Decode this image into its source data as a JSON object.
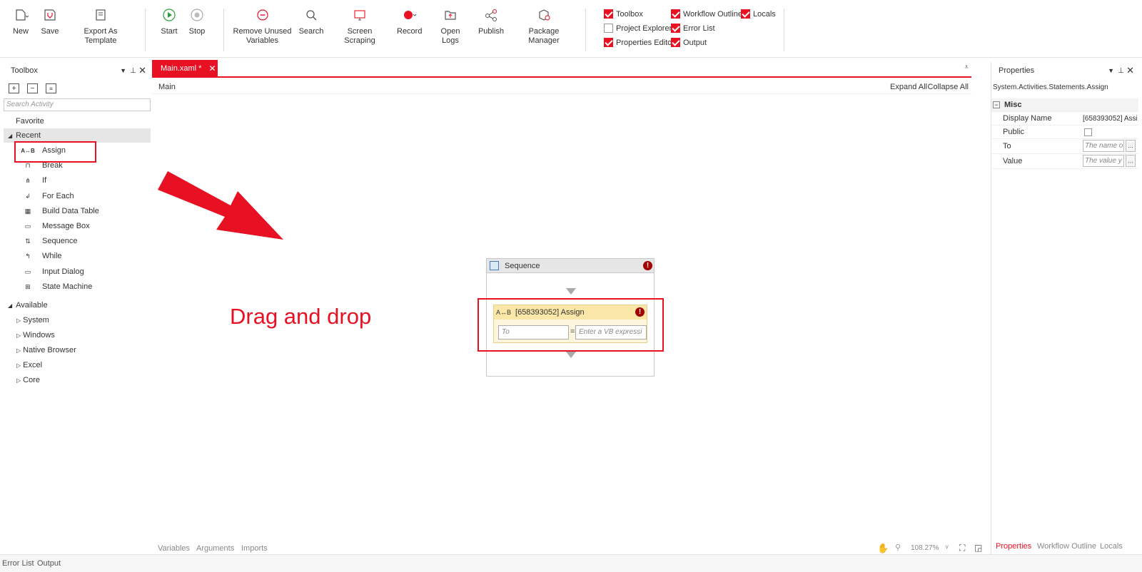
{
  "ribbon": {
    "new": "New",
    "save": "Save",
    "export_template": "Export As Template",
    "start": "Start",
    "stop": "Stop",
    "remove_unused_1": "Remove Unused",
    "remove_unused_2": "Variables",
    "search": "Search",
    "screen_scraping": "Screen Scraping",
    "record": "Record",
    "open_logs": "Open Logs",
    "publish": "Publish",
    "package_manager": "Package Manager",
    "panels": [
      {
        "label": "Toolbox",
        "checked": true
      },
      {
        "label": "Workflow Outline",
        "checked": true
      },
      {
        "label": "Locals",
        "checked": true
      },
      {
        "label": "Project Explorer",
        "checked": false
      },
      {
        "label": "Error List",
        "checked": true
      },
      {
        "label": "Properties Editor",
        "checked": true
      },
      {
        "label": "Output",
        "checked": true
      }
    ]
  },
  "toolbox": {
    "title": "Toolbox",
    "search_placeholder": "Search Activity",
    "favorite": "Favorite",
    "recent": "Recent",
    "recent_items": [
      "Assign",
      "Break",
      "If",
      "For Each",
      "Build Data Table",
      "Message Box",
      "Sequence",
      "While",
      "Input Dialog",
      "State Machine"
    ],
    "available": "Available",
    "available_items": [
      "System",
      "Windows",
      "Native Browser",
      "Excel",
      "Core"
    ]
  },
  "document": {
    "tab": "Main.xaml *",
    "breadcrumb": "Main",
    "expand_all": "Expand All",
    "collapse_all": "Collapse All",
    "annotation": "Drag and drop",
    "sequence_title": "Sequence",
    "assign_title": "[658393052] Assign",
    "assign_icon": "A↔B",
    "to_placeholder": "To",
    "value_placeholder": "Enter a VB expressi",
    "equals": "="
  },
  "canvas_footer": {
    "variables": "Variables",
    "arguments": "Arguments",
    "imports": "Imports",
    "zoom": "108.27%"
  },
  "properties": {
    "title": "Properties",
    "type": "System.Activities.Statements.Assign",
    "category": "Misc",
    "rows": [
      {
        "name": "Display Name",
        "value": "[658393052] Assi"
      },
      {
        "name": "Public",
        "value": ""
      },
      {
        "name": "To",
        "value": "The name o"
      },
      {
        "name": "Value",
        "value": "The value y"
      }
    ],
    "tabs": [
      "Properties",
      "Workflow Outline",
      "Locals"
    ]
  },
  "status": {
    "error_list": "Error List",
    "output": "Output"
  },
  "colors": {
    "accent": "#e81123",
    "warning_bg": "#fbe7a8"
  }
}
